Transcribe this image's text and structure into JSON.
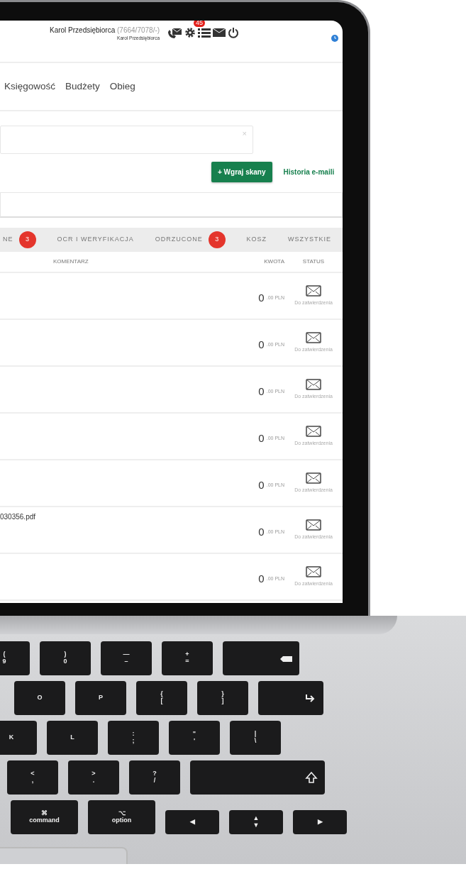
{
  "screen": {
    "header": {
      "user_name": "Karol Przedsiębiorca",
      "user_code": "(7664/7078/-)",
      "user_subtitle": "Karol Przedsiębiorca",
      "notification_count": "45"
    },
    "nav": [
      {
        "label": "Księgowość"
      },
      {
        "label": "Budżety"
      },
      {
        "label": "Obieg"
      }
    ],
    "search": {
      "clear": "×"
    },
    "upload_button": "+ Wgraj skany",
    "history_link": "Historia e-maili",
    "tabs": [
      {
        "label": "NE",
        "count": "3",
        "selected": false
      },
      {
        "label": "OCR I WERYFIKACJA",
        "selected": false
      },
      {
        "label": "ODRZUCONE",
        "count": "3",
        "selected": false
      },
      {
        "label": "KOSZ",
        "selected": false
      },
      {
        "label": "WSZYSTKIE",
        "selected": false
      }
    ],
    "columns": [
      "KOMENTARZ",
      "KWOTA",
      "STATUS"
    ],
    "rows": [
      {
        "amount": "0",
        "amount_suffix": ".00 PLN",
        "status": "Do zatwierdzenia"
      },
      {
        "amount": "0",
        "amount_suffix": ".00 PLN",
        "status": "Do zatwierdzenia"
      },
      {
        "amount": "0",
        "amount_suffix": ".00 PLN",
        "status": "Do zatwierdzenia"
      },
      {
        "amount": "0",
        "amount_suffix": ".00 PLN",
        "status": "Do zatwierdzenia"
      },
      {
        "amount": "0",
        "amount_suffix": ".00 PLN",
        "status": "Do zatwierdzenia"
      },
      {
        "file": "030356.pdf",
        "amount": "0",
        "amount_suffix": ".00 PLN",
        "status": "Do zatwierdzenia"
      },
      {
        "amount": "0",
        "amount_suffix": ".00 PLN",
        "status": "Do zatwierdzenia"
      }
    ]
  },
  "keyboard": {
    "key_rows": [
      {
        "keys": [
          {
            "kind": "letter",
            "legend": [
              "(",
              "9"
            ]
          },
          {
            "kind": "letter",
            "legend": [
              ")",
              "0"
            ]
          },
          {
            "kind": "letter",
            "legend": [
              "—",
              "–"
            ]
          },
          {
            "kind": "letter",
            "legend": [
              "+",
              "="
            ]
          },
          {
            "kind": "delete"
          }
        ]
      },
      {
        "keys": [
          {
            "kind": "letter",
            "legend": [
              "O"
            ]
          },
          {
            "kind": "letter",
            "legend": [
              "P"
            ]
          },
          {
            "kind": "letter",
            "legend": [
              "{",
              "["
            ]
          },
          {
            "kind": "letter",
            "legend": [
              "}",
              "]"
            ]
          },
          {
            "kind": "return"
          }
        ]
      },
      {
        "keys": [
          {
            "kind": "letter",
            "legend": [
              "K"
            ]
          },
          {
            "kind": "letter",
            "legend": [
              "L"
            ]
          },
          {
            "kind": "letter",
            "legend": [
              ":",
              ";"
            ]
          },
          {
            "kind": "letter",
            "legend": [
              "\"",
              "'"
            ]
          },
          {
            "kind": "letter",
            "legend": [
              "|",
              "\\"
            ]
          }
        ]
      },
      {
        "keys": [
          {
            "kind": "letter",
            "legend": [
              "<",
              ","
            ]
          },
          {
            "kind": "letter",
            "legend": [
              ">",
              "."
            ]
          },
          {
            "kind": "letter",
            "legend": [
              "?",
              "/"
            ]
          },
          {
            "kind": "shift"
          }
        ]
      },
      {
        "keys": [
          {
            "kind": "modifier",
            "legend": [
              "⌘",
              "command"
            ]
          },
          {
            "kind": "modifier",
            "legend": [
              "⌥",
              "option"
            ]
          },
          {
            "kind": "arrow",
            "legend": [
              "◀"
            ]
          },
          {
            "kind": "arrow",
            "legend": [
              "▲",
              "▼"
            ]
          },
          {
            "kind": "arrow",
            "legend": [
              "▶"
            ]
          }
        ]
      }
    ]
  }
}
